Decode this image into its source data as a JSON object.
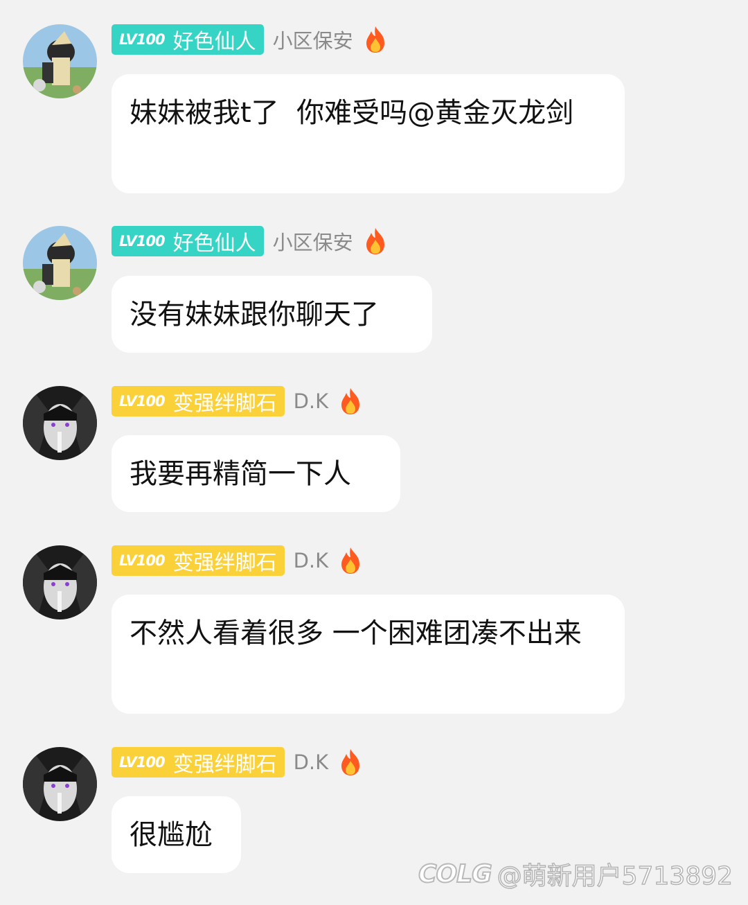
{
  "messages": [
    {
      "avatar_icon": "anime-character-avatar-icon",
      "badge_level": "LV100",
      "badge_title": "好色仙人",
      "badge_color": "#35d4c4",
      "username": "小区保安",
      "status_icon": "fire-icon",
      "text": "妹妹被我t了  你难受吗@黄金灭龙剑"
    },
    {
      "avatar_icon": "anime-character-avatar-icon",
      "badge_level": "LV100",
      "badge_title": "好色仙人",
      "badge_color": "#35d4c4",
      "username": "小区保安",
      "status_icon": "fire-icon",
      "text": "没有妹妹跟你聊天了"
    },
    {
      "avatar_icon": "dark-anime-character-avatar-icon",
      "badge_level": "LV100",
      "badge_title": "变强绊脚石",
      "badge_color": "#fbd13a",
      "username": "D.K",
      "status_icon": "fire-icon",
      "text": "我要再精简一下人"
    },
    {
      "avatar_icon": "dark-anime-character-avatar-icon",
      "badge_level": "LV100",
      "badge_title": "变强绊脚石",
      "badge_color": "#fbd13a",
      "username": "D.K",
      "status_icon": "fire-icon",
      "text": "不然人看着很多 一个困难团凑不出来"
    },
    {
      "avatar_icon": "dark-anime-character-avatar-icon",
      "badge_level": "LV100",
      "badge_title": "变强绊脚石",
      "badge_color": "#fbd13a",
      "username": "D.K",
      "status_icon": "fire-icon",
      "text": "很尴尬"
    }
  ],
  "watermark": {
    "logo": "COLG",
    "text": "@萌新用户5713892"
  }
}
